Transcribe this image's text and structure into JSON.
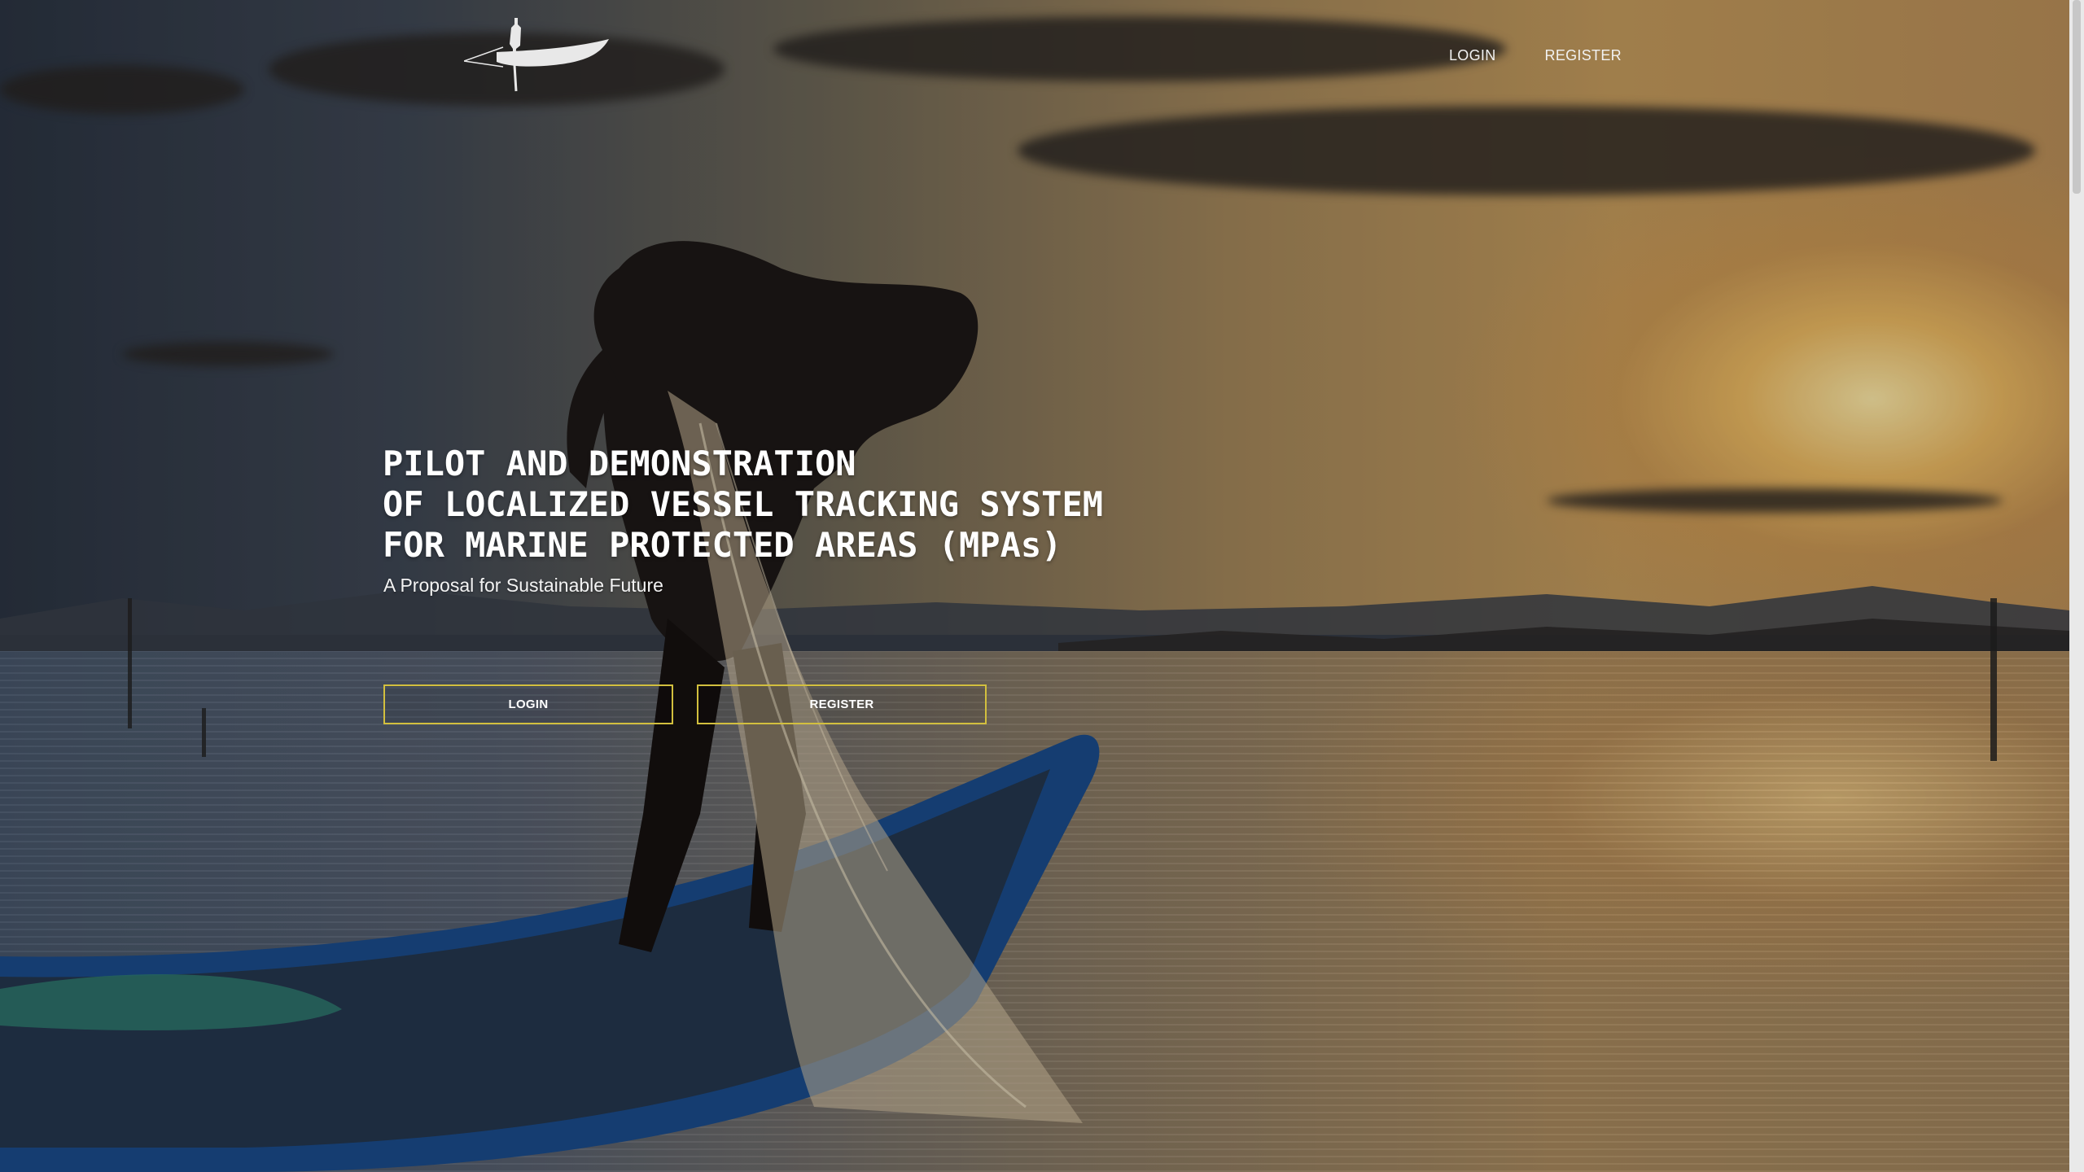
{
  "nav": {
    "login_label": "LOGIN",
    "register_label": "REGISTER"
  },
  "hero": {
    "title_lines": [
      "PILOT AND DEMONSTRATION",
      "OF LOCALIZED VESSEL TRACKING SYSTEM",
      "FOR MARINE PROTECTED AREAS (MPAs)"
    ],
    "subtitle": "A Proposal for Sustainable Future",
    "login_button": "LOGIN",
    "register_button": "REGISTER"
  },
  "icons": {
    "logo": "fisherman-boat-logo"
  },
  "colors": {
    "button_border": "#d2bf3e",
    "text": "#ffffff"
  }
}
